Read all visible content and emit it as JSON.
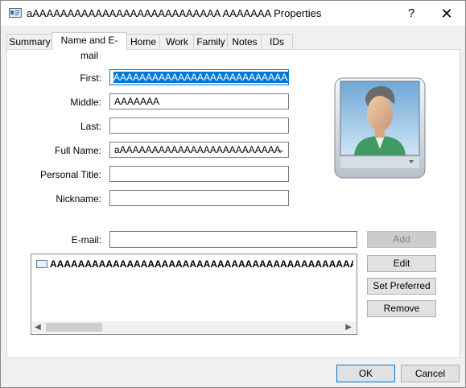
{
  "window": {
    "title": "aAAAAAAAAAAAAAAAAAAAAAAAAAAA AAAAAAA Properties",
    "help_label": "?",
    "close_label": "✕"
  },
  "tabs": [
    {
      "label": "Summary"
    },
    {
      "label": "Name and E-mail"
    },
    {
      "label": "Home"
    },
    {
      "label": "Work"
    },
    {
      "label": "Family"
    },
    {
      "label": "Notes"
    },
    {
      "label": "IDs"
    }
  ],
  "form": {
    "first_label": "First:",
    "first_value": "AAAAAAAAAAAAAAAAAAAAAAAAAAAA",
    "middle_label": "Middle:",
    "middle_value": "AAAAAAA",
    "last_label": "Last:",
    "last_value": "",
    "fullname_label": "Full Name:",
    "fullname_value": "aAAAAAAAAAAAAAAAAAAAAAAAAA",
    "title_label": "Personal Title:",
    "title_value": "",
    "nickname_label": "Nickname:",
    "nickname_value": "",
    "email_label": "E-mail:",
    "email_value": ""
  },
  "email_list": {
    "items": [
      "AAAAAAAAAAAAAAAAAAAAAAAAAAAAAAAAAAAAAAAAAAAAAAAA"
    ]
  },
  "buttons": {
    "add": "Add",
    "edit": "Edit",
    "set_preferred": "Set Preferred",
    "remove": "Remove",
    "ok": "OK",
    "cancel": "Cancel"
  }
}
